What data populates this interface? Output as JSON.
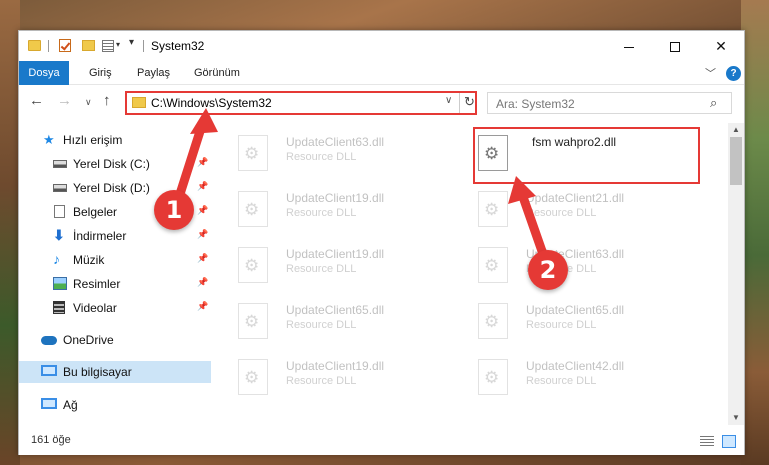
{
  "window": {
    "title": "System32",
    "controls": {
      "minimize": "",
      "maximize": "",
      "close": "✕"
    }
  },
  "quick_access_toolbar": {
    "dropdown": "▾"
  },
  "ribbon": {
    "tabs": [
      {
        "label": "Dosya",
        "active": true
      },
      {
        "label": "Giriş"
      },
      {
        "label": "Paylaş"
      },
      {
        "label": "Görünüm"
      }
    ],
    "collapse": "﹀",
    "help": "?"
  },
  "navigation": {
    "back": "←",
    "forward": "→",
    "recent": "∨",
    "up": "↑",
    "address": "C:\\Windows\\System32",
    "address_dropdown": "∨",
    "refresh": "↻",
    "search_placeholder": "Ara: System32",
    "search_icon": "⌕"
  },
  "sidebar": {
    "items": [
      {
        "label": "Hızlı erişim",
        "icon": "star-icon",
        "pinned": false
      },
      {
        "label": "Yerel Disk (C:)",
        "icon": "drive-icon",
        "pinned": true
      },
      {
        "label": "Yerel Disk (D:)",
        "icon": "drive-icon",
        "pinned": true
      },
      {
        "label": "Belgeler",
        "icon": "document-icon",
        "pinned": true
      },
      {
        "label": "İndirmeler",
        "icon": "download-icon",
        "pinned": true
      },
      {
        "label": "Müzik",
        "icon": "music-icon",
        "pinned": true
      },
      {
        "label": "Resimler",
        "icon": "pictures-icon",
        "pinned": true
      },
      {
        "label": "Videolar",
        "icon": "video-icon",
        "pinned": true
      },
      {
        "label": "OneDrive",
        "icon": "onedrive-icon",
        "pinned": false
      },
      {
        "label": "Bu bilgisayar",
        "icon": "computer-icon",
        "pinned": false,
        "selected": true
      },
      {
        "label": "Ağ",
        "icon": "network-icon",
        "pinned": false
      }
    ],
    "pin_glyph": "📌"
  },
  "files": [
    {
      "name": "UpdateClient63.dll",
      "type": "Resource DLL",
      "faded": true
    },
    {
      "name": "fsm wahpro2.dll",
      "type": "",
      "faded": false,
      "highlighted": true
    },
    {
      "name": "UpdateClient19.dll",
      "type": "Resource DLL",
      "faded": true
    },
    {
      "name": "UpdateClient21.dll",
      "type": "Resource DLL",
      "faded": true
    },
    {
      "name": "UpdateClient19.dll",
      "type": "Resource DLL",
      "faded": true
    },
    {
      "name": "UpdateClient63.dll",
      "type": "Resource DLL",
      "faded": true
    },
    {
      "name": "UpdateClient65.dll",
      "type": "Resource DLL",
      "faded": true
    },
    {
      "name": "UpdateClient65.dll",
      "type": "Resource DLL",
      "faded": true
    },
    {
      "name": "UpdateClient19.dll",
      "type": "Resource DLL",
      "faded": true
    },
    {
      "name": "UpdateClient42.dll",
      "type": "Resource DLL",
      "faded": true
    }
  ],
  "status": {
    "item_count": "161 öğe"
  },
  "annotations": [
    {
      "number": "1",
      "color": "#e53935"
    },
    {
      "number": "2",
      "color": "#e53935"
    }
  ],
  "colors": {
    "accent": "#1979ca",
    "highlight": "#e53935",
    "selection": "#cce4f7"
  }
}
